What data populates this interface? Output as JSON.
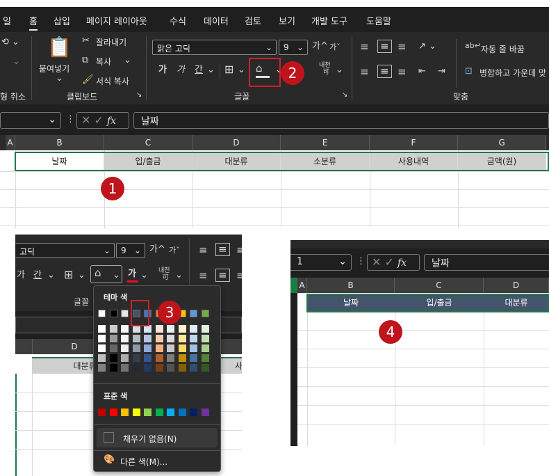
{
  "menu": {
    "items": [
      "일",
      "홈",
      "삽입",
      "페이지 레이아웃",
      "수식",
      "데이터",
      "검토",
      "보기",
      "개발 도구",
      "도움말"
    ]
  },
  "ribbon": {
    "undo_label": "취소",
    "paste_label": "붙여넣기",
    "cut_label": "잘라내기",
    "copy_label": "복사",
    "format_painter_label": "서식 복사",
    "clipboard_group": "클립보드",
    "font_name": "맑은 고딕",
    "font_size": "9",
    "grow_font": "가",
    "shrink_font": "가",
    "bold": "가",
    "italic": "가",
    "underline": "간",
    "phonetic": "내천",
    "font_group": "글꼴",
    "wrap_text": "자동 줄 바꿈",
    "merge_center": "병합하고 가운데 맞",
    "align_group": "맞춤"
  },
  "formula_bar": {
    "content": "날짜",
    "fx": "fx"
  },
  "sheet": {
    "columns": [
      "A",
      "B",
      "C",
      "D",
      "E",
      "F",
      "G"
    ],
    "headers": [
      "날짜",
      "입/출금",
      "대분류",
      "소분류",
      "사용내역",
      "금액(원)"
    ]
  },
  "panel3": {
    "font_name": "고딕",
    "font_size": "9",
    "font_color_label": "가",
    "underline": "간",
    "phonetic": "내천",
    "font_group": "글꼴",
    "col_d": "D",
    "cell_d": "대분류",
    "theme_colors_title": "테마 색",
    "standard_colors_title": "표준 색",
    "no_fill": "채우기 없음(N)",
    "more_colors": "다른 색(M)...",
    "cut_text": "사",
    "theme_top": [
      "#ffffff",
      "#000000",
      "#e7e6e6",
      "#44546a",
      "#4472c4",
      "#ed7d31",
      "#a5a5a5",
      "#ffc000",
      "#5b9bd5",
      "#70ad47"
    ],
    "standard": [
      "#c00000",
      "#ff0000",
      "#ffc000",
      "#ffff00",
      "#92d050",
      "#00b050",
      "#00b0f0",
      "#0070c0",
      "#002060",
      "#7030a0"
    ]
  },
  "panel4": {
    "name_box": "1",
    "formula": "날짜",
    "fx": "fx",
    "columns": [
      "A",
      "B",
      "C",
      "D"
    ],
    "headers": [
      "날짜",
      "입/출금",
      "대분류"
    ],
    "header_fill": "#44546a"
  },
  "steps": [
    "1",
    "2",
    "3",
    "4"
  ],
  "accent": "#c0141c"
}
